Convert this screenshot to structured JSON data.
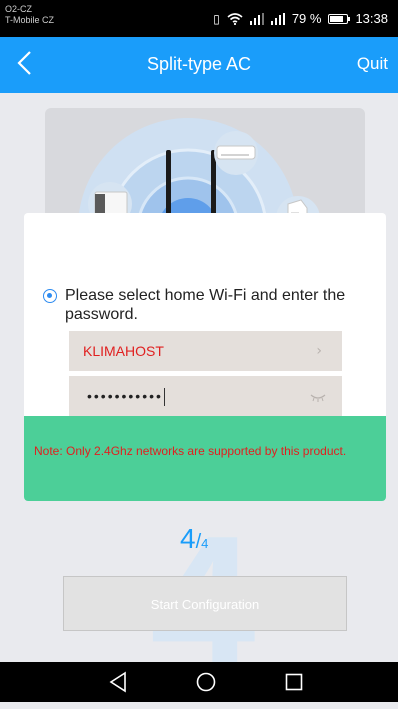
{
  "status_bar": {
    "carrier_line1": "O2-CZ",
    "carrier_line2": "T-Mobile CZ",
    "battery_percent": "79 %",
    "battery_level": 0.79,
    "time": "13:38",
    "icons": [
      "vibrate-icon",
      "wifi-icon",
      "signal-icon",
      "signal-icon",
      "battery-icon"
    ]
  },
  "header": {
    "back_icon": "chevron-left-icon",
    "title": "Split-type AC",
    "quit_label": "Quit"
  },
  "form": {
    "instruction": "Please select home Wi-Fi and enter the password.",
    "ssid_value": "KLIMAHOST",
    "password_mask": "•••••••••••",
    "note": "Note: Only 2.4Ghz networks are supported by this product."
  },
  "progress": {
    "background_digit": "4",
    "current": "4",
    "separator": "/",
    "total": "4"
  },
  "actions": {
    "start_label": "Start Configuration"
  },
  "colors": {
    "accent": "#1a9dfa",
    "note_bg": "#4ccf98",
    "error_text": "#e02020"
  }
}
